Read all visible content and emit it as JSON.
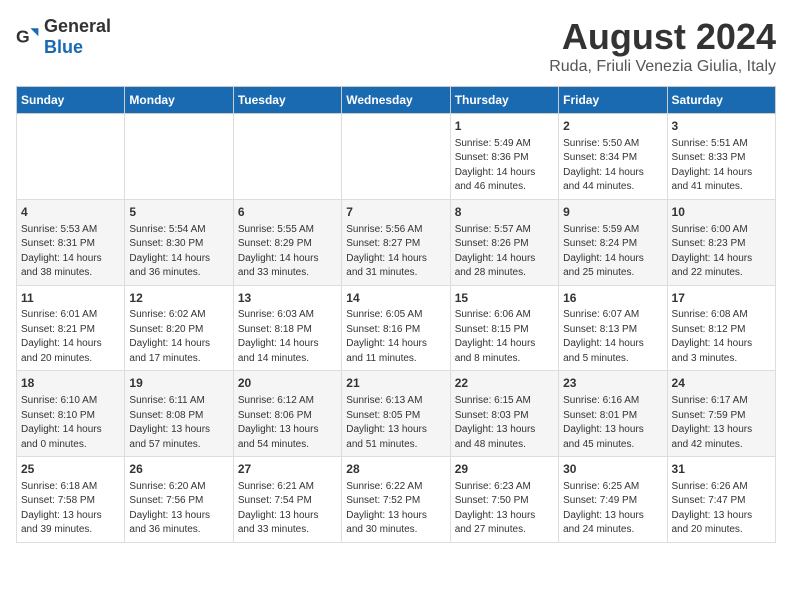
{
  "logo": {
    "general": "General",
    "blue": "Blue"
  },
  "title": "August 2024",
  "subtitle": "Ruda, Friuli Venezia Giulia, Italy",
  "days_of_week": [
    "Sunday",
    "Monday",
    "Tuesday",
    "Wednesday",
    "Thursday",
    "Friday",
    "Saturday"
  ],
  "weeks": [
    [
      {
        "day": "",
        "content": ""
      },
      {
        "day": "",
        "content": ""
      },
      {
        "day": "",
        "content": ""
      },
      {
        "day": "",
        "content": ""
      },
      {
        "day": "1",
        "content": "Sunrise: 5:49 AM\nSunset: 8:36 PM\nDaylight: 14 hours\nand 46 minutes."
      },
      {
        "day": "2",
        "content": "Sunrise: 5:50 AM\nSunset: 8:34 PM\nDaylight: 14 hours\nand 44 minutes."
      },
      {
        "day": "3",
        "content": "Sunrise: 5:51 AM\nSunset: 8:33 PM\nDaylight: 14 hours\nand 41 minutes."
      }
    ],
    [
      {
        "day": "4",
        "content": "Sunrise: 5:53 AM\nSunset: 8:31 PM\nDaylight: 14 hours\nand 38 minutes."
      },
      {
        "day": "5",
        "content": "Sunrise: 5:54 AM\nSunset: 8:30 PM\nDaylight: 14 hours\nand 36 minutes."
      },
      {
        "day": "6",
        "content": "Sunrise: 5:55 AM\nSunset: 8:29 PM\nDaylight: 14 hours\nand 33 minutes."
      },
      {
        "day": "7",
        "content": "Sunrise: 5:56 AM\nSunset: 8:27 PM\nDaylight: 14 hours\nand 31 minutes."
      },
      {
        "day": "8",
        "content": "Sunrise: 5:57 AM\nSunset: 8:26 PM\nDaylight: 14 hours\nand 28 minutes."
      },
      {
        "day": "9",
        "content": "Sunrise: 5:59 AM\nSunset: 8:24 PM\nDaylight: 14 hours\nand 25 minutes."
      },
      {
        "day": "10",
        "content": "Sunrise: 6:00 AM\nSunset: 8:23 PM\nDaylight: 14 hours\nand 22 minutes."
      }
    ],
    [
      {
        "day": "11",
        "content": "Sunrise: 6:01 AM\nSunset: 8:21 PM\nDaylight: 14 hours\nand 20 minutes."
      },
      {
        "day": "12",
        "content": "Sunrise: 6:02 AM\nSunset: 8:20 PM\nDaylight: 14 hours\nand 17 minutes."
      },
      {
        "day": "13",
        "content": "Sunrise: 6:03 AM\nSunset: 8:18 PM\nDaylight: 14 hours\nand 14 minutes."
      },
      {
        "day": "14",
        "content": "Sunrise: 6:05 AM\nSunset: 8:16 PM\nDaylight: 14 hours\nand 11 minutes."
      },
      {
        "day": "15",
        "content": "Sunrise: 6:06 AM\nSunset: 8:15 PM\nDaylight: 14 hours\nand 8 minutes."
      },
      {
        "day": "16",
        "content": "Sunrise: 6:07 AM\nSunset: 8:13 PM\nDaylight: 14 hours\nand 5 minutes."
      },
      {
        "day": "17",
        "content": "Sunrise: 6:08 AM\nSunset: 8:12 PM\nDaylight: 14 hours\nand 3 minutes."
      }
    ],
    [
      {
        "day": "18",
        "content": "Sunrise: 6:10 AM\nSunset: 8:10 PM\nDaylight: 14 hours\nand 0 minutes."
      },
      {
        "day": "19",
        "content": "Sunrise: 6:11 AM\nSunset: 8:08 PM\nDaylight: 13 hours\nand 57 minutes."
      },
      {
        "day": "20",
        "content": "Sunrise: 6:12 AM\nSunset: 8:06 PM\nDaylight: 13 hours\nand 54 minutes."
      },
      {
        "day": "21",
        "content": "Sunrise: 6:13 AM\nSunset: 8:05 PM\nDaylight: 13 hours\nand 51 minutes."
      },
      {
        "day": "22",
        "content": "Sunrise: 6:15 AM\nSunset: 8:03 PM\nDaylight: 13 hours\nand 48 minutes."
      },
      {
        "day": "23",
        "content": "Sunrise: 6:16 AM\nSunset: 8:01 PM\nDaylight: 13 hours\nand 45 minutes."
      },
      {
        "day": "24",
        "content": "Sunrise: 6:17 AM\nSunset: 7:59 PM\nDaylight: 13 hours\nand 42 minutes."
      }
    ],
    [
      {
        "day": "25",
        "content": "Sunrise: 6:18 AM\nSunset: 7:58 PM\nDaylight: 13 hours\nand 39 minutes."
      },
      {
        "day": "26",
        "content": "Sunrise: 6:20 AM\nSunset: 7:56 PM\nDaylight: 13 hours\nand 36 minutes."
      },
      {
        "day": "27",
        "content": "Sunrise: 6:21 AM\nSunset: 7:54 PM\nDaylight: 13 hours\nand 33 minutes."
      },
      {
        "day": "28",
        "content": "Sunrise: 6:22 AM\nSunset: 7:52 PM\nDaylight: 13 hours\nand 30 minutes."
      },
      {
        "day": "29",
        "content": "Sunrise: 6:23 AM\nSunset: 7:50 PM\nDaylight: 13 hours\nand 27 minutes."
      },
      {
        "day": "30",
        "content": "Sunrise: 6:25 AM\nSunset: 7:49 PM\nDaylight: 13 hours\nand 24 minutes."
      },
      {
        "day": "31",
        "content": "Sunrise: 6:26 AM\nSunset: 7:47 PM\nDaylight: 13 hours\nand 20 minutes."
      }
    ]
  ]
}
